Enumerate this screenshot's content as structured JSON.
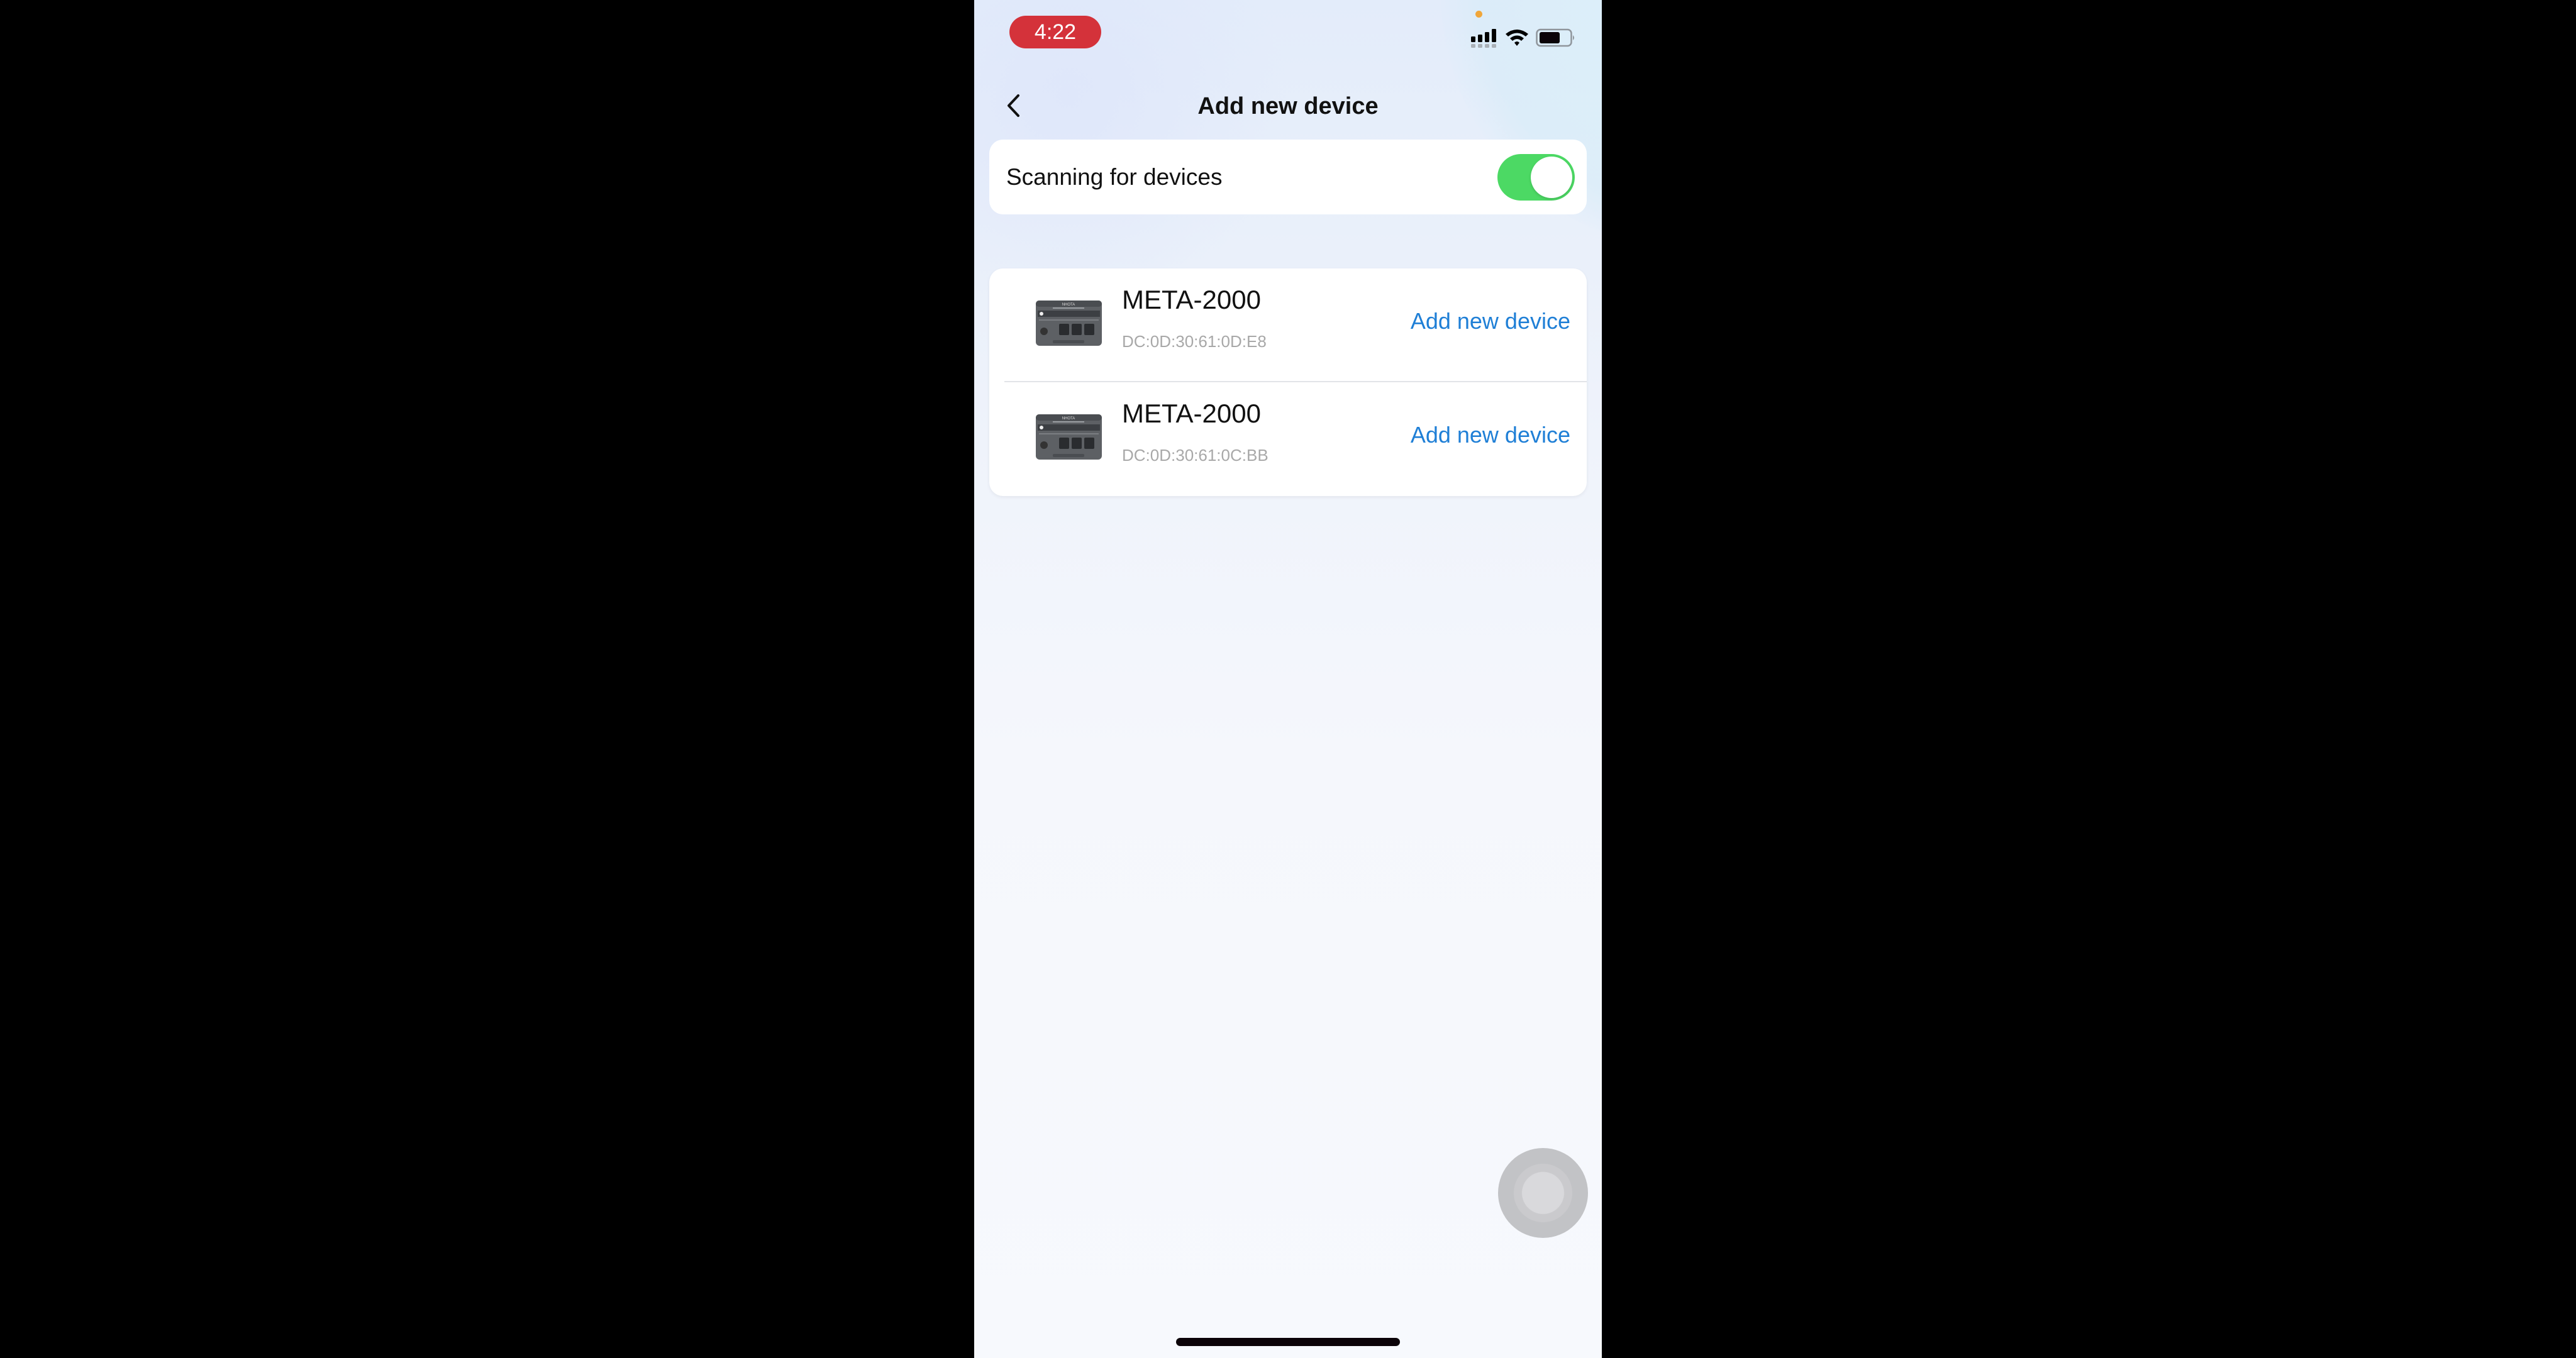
{
  "status_bar": {
    "time": "4:22",
    "signal_icon": "cellular-signal-icon",
    "wifi_icon": "wifi-icon",
    "battery_icon": "battery-icon",
    "privacy_indicator_color": "#f0a63a",
    "time_pill_color": "#d4323a"
  },
  "header": {
    "back_icon": "chevron-left-icon",
    "title": "Add new device"
  },
  "scan": {
    "label": "Scanning for devices",
    "enabled": true,
    "toggle_color": "#4cd964"
  },
  "devices": [
    {
      "name": "META-2000",
      "mac": "DC:0D:30:61:0D:E8",
      "action": "Add new device",
      "icon": "power-station-icon"
    },
    {
      "name": "META-2000",
      "mac": "DC:0D:30:61:0C:BB",
      "action": "Add new device",
      "icon": "power-station-icon"
    }
  ],
  "colors": {
    "link": "#1f7fd6",
    "mac_text": "#a8a8a8"
  }
}
